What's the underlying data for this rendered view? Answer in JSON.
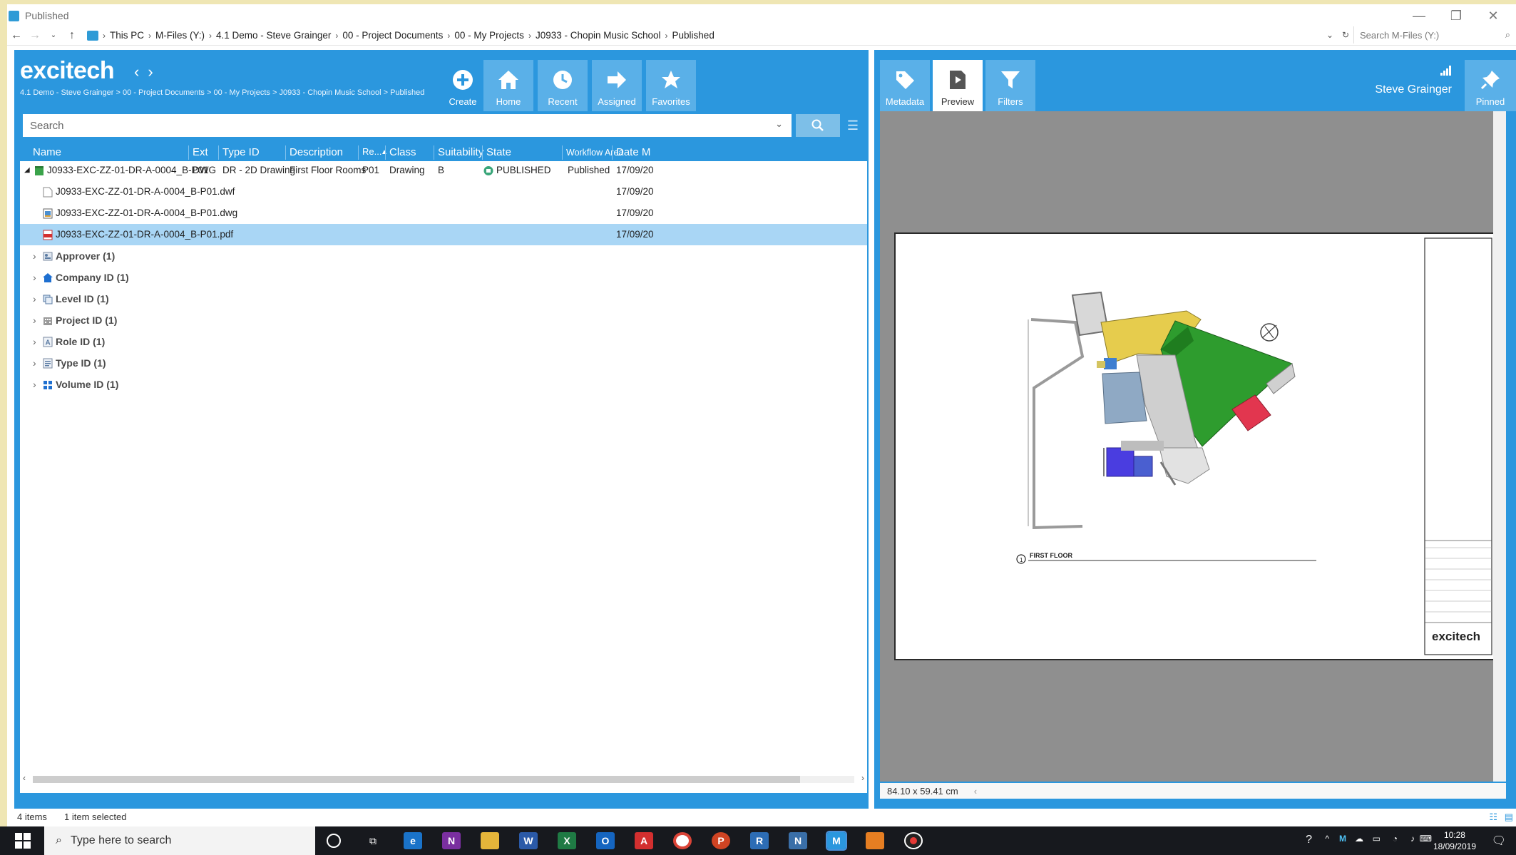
{
  "window": {
    "title": "Published"
  },
  "address": {
    "crumbs": [
      "This PC",
      "M-Files (Y:)",
      "4.1 Demo - Steve Grainger",
      "00 - Project Documents",
      "00 - My Projects",
      "J0933 - Chopin Music School",
      "Published"
    ],
    "search_placeholder": "Search M-Files (Y:)"
  },
  "header": {
    "brand": "excitech",
    "path": "4.1 Demo - Steve Grainger > 00 - Project Documents > 00 - My Projects > J0933 - Chopin Music School > Published",
    "toolbar": [
      "Create",
      "Home",
      "Recent",
      "Assigned",
      "Favorites"
    ]
  },
  "search": {
    "placeholder": "Search"
  },
  "columns": [
    "Name",
    "Ext",
    "Type ID",
    "Description",
    "Re...",
    "Class",
    "Suitability",
    "State",
    "Workflow Area",
    "Date M"
  ],
  "document": {
    "name": "J0933-EXC-ZZ-01-DR-A-0004_B-P01",
    "ext": "DWG",
    "type_id": "DR - 2D Drawing",
    "description": "First Floor Rooms",
    "revision": "P01",
    "class": "Drawing",
    "suitability": "B",
    "state": "PUBLISHED",
    "workflow_area": "Published",
    "date": "17/09/20"
  },
  "files": [
    {
      "name": "J0933-EXC-ZZ-01-DR-A-0004_B-P01.dwf",
      "date": "17/09/20",
      "icon": "blank-file-icon"
    },
    {
      "name": "J0933-EXC-ZZ-01-DR-A-0004_B-P01.dwg",
      "date": "17/09/20",
      "icon": "dwg-file-icon"
    },
    {
      "name": "J0933-EXC-ZZ-01-DR-A-0004_B-P01.pdf",
      "date": "17/09/20",
      "icon": "pdf-file-icon"
    }
  ],
  "groups": [
    "Approver (1)",
    "Company ID (1)",
    "Level ID (1)",
    "Project ID (1)",
    "Role ID (1)",
    "Type ID (1)",
    "Volume ID (1)"
  ],
  "right_toolbar": [
    "Metadata",
    "Preview",
    "Filters"
  ],
  "user": {
    "name": "Steve Grainger",
    "pinned": "Pinned"
  },
  "preview": {
    "drawing_title": "FIRST FLOOR",
    "logo": "excitech",
    "sheet_size": "84.10 x 59.41 cm"
  },
  "status": {
    "items": "4 items",
    "selected": "1 item selected"
  },
  "taskbar": {
    "search_placeholder": "Type here to search",
    "time": "10:28",
    "date": "18/09/2019"
  },
  "colors": {
    "accent": "#2b97de",
    "selection": "#a9d6f5",
    "published_state": "#3aa67a"
  }
}
